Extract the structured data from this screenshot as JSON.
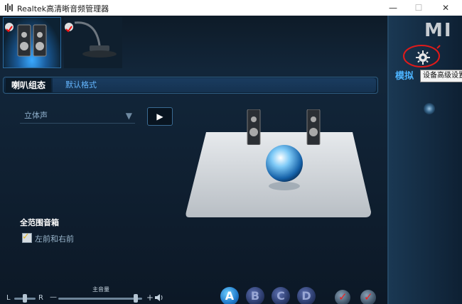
{
  "window": {
    "title": "Realtek高清晰音频管理器",
    "minimize": "—",
    "maximize": "☐",
    "close": "✕"
  },
  "right_panel": {
    "logo": "MI",
    "mode_label": "模拟",
    "tooltip": "设备高级设置"
  },
  "tabs": {
    "active": "喇叭组态",
    "default_format": "默认格式"
  },
  "speaker_config": {
    "selected": "立体声",
    "full_range_heading": "全范围音箱",
    "front_lr_label": "左前和右前",
    "front_lr_checked": true
  },
  "bottom": {
    "balance_left": "L",
    "balance_right": "R",
    "main_volume_label": "主音量",
    "minus": "—",
    "plus": "+",
    "badges": [
      "A",
      "B",
      "C",
      "D"
    ]
  },
  "colors": {
    "accent": "#4db4ff",
    "background": "#0f1e2d",
    "annotation_red": "#e01a1a"
  }
}
